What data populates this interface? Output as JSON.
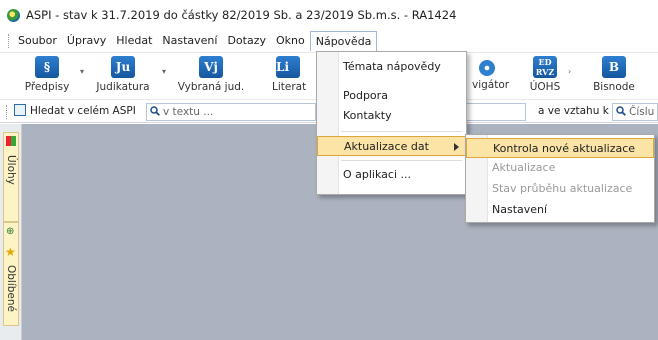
{
  "window": {
    "title": "ASPI  - stav k 31.7.2019 do částky 82/2019 Sb. a 23/2019 Sb.m.s. - RA1424"
  },
  "menubar": {
    "items": [
      "Soubor",
      "Úpravy",
      "Hledat",
      "Nastavení",
      "Dotazy",
      "Okno",
      "Nápověda"
    ],
    "active": "Nápověda"
  },
  "toolbar": {
    "buttons": [
      {
        "icon": "§",
        "label": "Předpisy"
      },
      {
        "icon": "Ju",
        "label": "Judikatura"
      },
      {
        "icon": "Vj",
        "label": "Vybraná jud."
      },
      {
        "icon": "Li",
        "label": "Literat"
      },
      {
        "icon": "",
        "label": "vigátor"
      },
      {
        "icon": "ED RVZ",
        "label": "ÚOHS"
      },
      {
        "icon": "B",
        "label": "Bisnode"
      }
    ]
  },
  "searchbar": {
    "scope_label": "Hledat v celém ASPI",
    "text_placeholder": "v textu ...",
    "relation_label": "a ve vztahu k",
    "number_placeholder": "Číslu"
  },
  "sidebar": {
    "tab_tasks": "Úlohy",
    "tab_favorites": "Oblíbené"
  },
  "help_menu": {
    "items": [
      "Témata nápovědy",
      "Podpora",
      "Kontakty",
      "Aktualizace dat",
      "O aplikaci ..."
    ],
    "highlighted": "Aktualizace dat"
  },
  "update_submenu": {
    "items": [
      {
        "label": "Kontrola nové aktualizace",
        "state": "highlighted"
      },
      {
        "label": "Aktualizace",
        "state": "disabled"
      },
      {
        "label": "Stav průběhu aktualizace",
        "state": "disabled"
      },
      {
        "label": "Nastavení",
        "state": "enabled"
      }
    ]
  },
  "colors": {
    "workspace": "#aab3bf",
    "highlight": "#fbe4a5",
    "highlight_border": "#e0a63b",
    "icon_blue": "#15579f"
  }
}
